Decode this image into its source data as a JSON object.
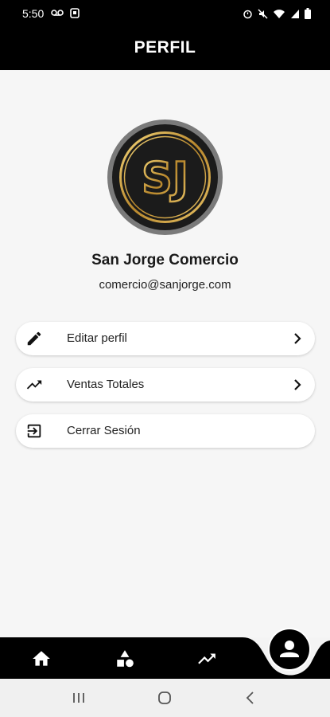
{
  "status_bar": {
    "time": "5:50",
    "left_icons": [
      "voicemail-icon",
      "notification-box-icon"
    ],
    "right_icons": [
      "alarm-icon",
      "mute-icon",
      "wifi-icon",
      "signal-icon",
      "battery-icon"
    ]
  },
  "app_bar": {
    "title": "PERFIL"
  },
  "profile": {
    "name": "San Jorge Comercio",
    "email": "comercio@sanjorge.com",
    "logo_text": "SJ"
  },
  "menu": [
    {
      "label": "Editar perfil",
      "icon": "pencil-icon",
      "chevron": true
    },
    {
      "label": "Ventas Totales",
      "icon": "trending-up-icon",
      "chevron": true
    },
    {
      "label": "Cerrar Sesión",
      "icon": "logout-icon",
      "chevron": false
    }
  ],
  "bottom_nav": {
    "items": [
      "home-icon",
      "shapes-icon",
      "trending-up-icon",
      "person-icon"
    ],
    "active": "person-icon"
  },
  "colors": {
    "bar": "#000000",
    "background": "#f6f6f6",
    "card": "#ffffff",
    "gold": "#c9a24a"
  }
}
